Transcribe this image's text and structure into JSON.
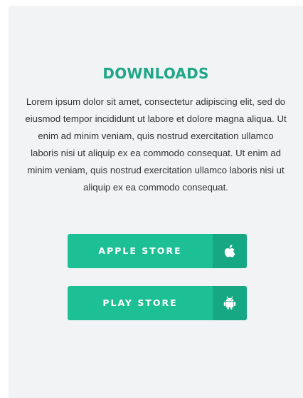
{
  "downloads": {
    "title": "DOWNLOADS",
    "description": "Lorem ipsum dolor sit amet, consectetur adipiscing elit, sed do eiusmod tempor incididunt ut labore et dolore magna aliqua. Ut enim ad minim veniam, quis nostrud exercitation ullamco laboris nisi ut aliquip ex ea commodo consequat. Ut enim ad minim veniam, quis nostrud exercitation ullamco laboris nisi ut aliquip ex ea commodo consequat.",
    "buttons": [
      {
        "label": "APPLE STORE",
        "icon": "apple-icon"
      },
      {
        "label": "PLAY STORE",
        "icon": "android-icon"
      }
    ]
  },
  "colors": {
    "accent": "#1fa787",
    "button": "#1dbf95",
    "button_icon_bg": "#15a883",
    "panel_bg": "#f2f3f5",
    "text": "#333333"
  }
}
